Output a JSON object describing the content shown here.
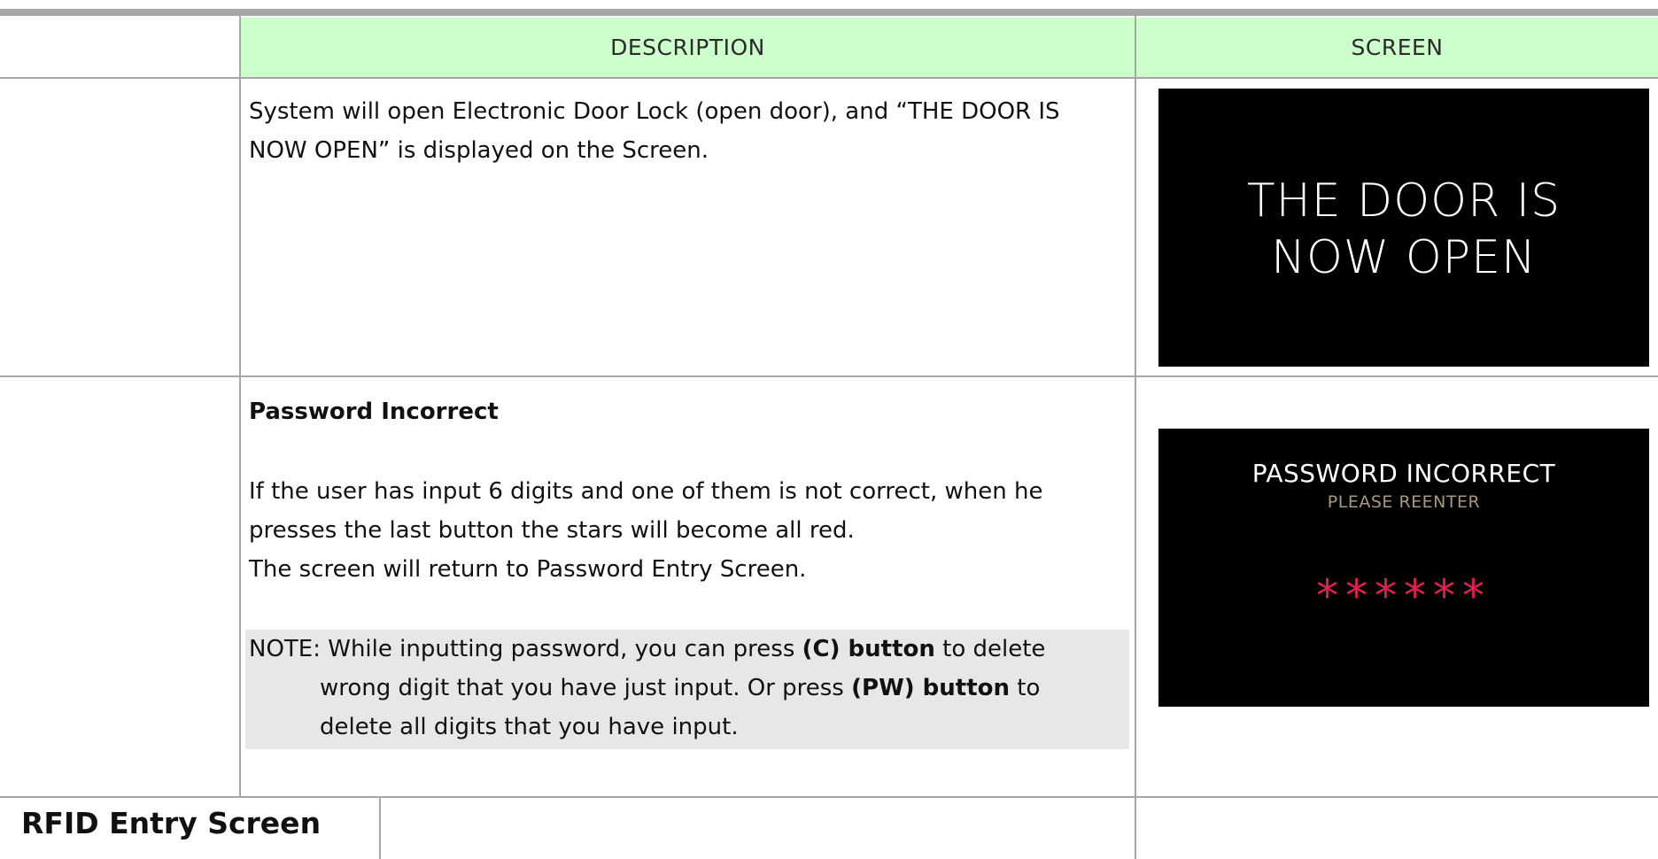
{
  "header": {
    "description": "DESCRIPTION",
    "screen": "SCREEN"
  },
  "row_door_open": {
    "text_line1": "System will open Electronic Door Lock (open door), and “THE DOOR IS",
    "text_line2": "NOW OPEN” is displayed on the Screen.",
    "screen_line1": "THE DOOR IS",
    "screen_line2": "NOW OPEN"
  },
  "row_password_incorrect": {
    "heading": "Password Incorrect",
    "para_line1": "If the user has input 6 digits and one of them is not correct, when he",
    "para_line2": "presses the last button the stars will become all red.",
    "para_line3": "The screen will return to Password Entry Screen.",
    "note": {
      "prefix": "NOTE: While inputting password, you can press ",
      "c_button": "(C) button",
      "mid1": " to delete",
      "line2_a": "wrong digit that you have just input. Or press ",
      "pw_button": "(PW) button",
      "line2_b": " to",
      "line3": "delete all digits that you have input."
    },
    "screen_title": "PASSWORD INCORRECT",
    "screen_subtitle": "PLEASE REENTER",
    "screen_stars": "******",
    "stars_color": "#e0204c"
  },
  "section": {
    "rfid_title": "RFID Entry Screen"
  }
}
